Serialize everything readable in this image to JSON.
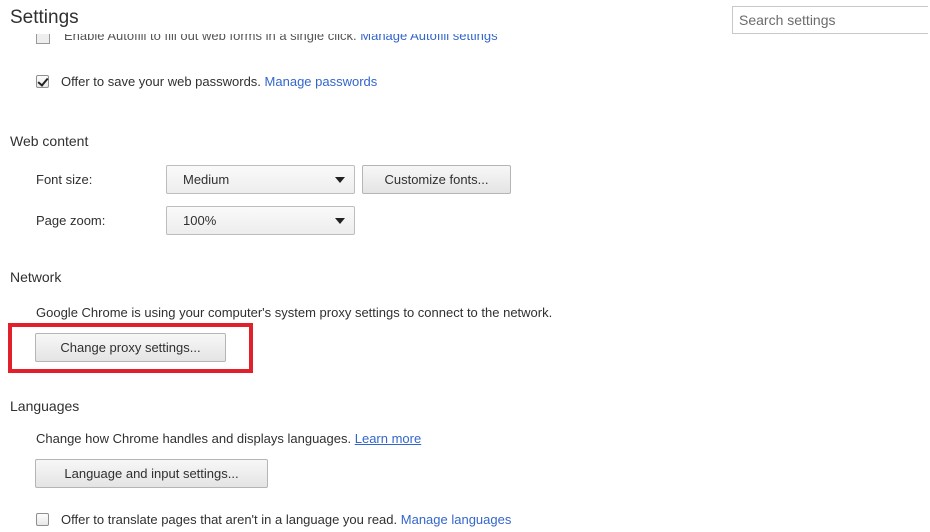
{
  "header": {
    "title": "Settings",
    "search_placeholder": "Search settings"
  },
  "passwords": {
    "autofill_clipped_text": "Enable Autofill to fill out web forms in a single click.",
    "autofill_clipped_link": "Manage Autofill settings",
    "offer_save_label": "Offer to save your web passwords.",
    "offer_save_checked": true,
    "manage_passwords_link": "Manage passwords"
  },
  "web_content": {
    "title": "Web content",
    "font_size_label": "Font size:",
    "font_size_value": "Medium",
    "customize_fonts_button": "Customize fonts...",
    "page_zoom_label": "Page zoom:",
    "page_zoom_value": "100%"
  },
  "network": {
    "title": "Network",
    "description": "Google Chrome is using your computer's system proxy settings to connect to the network.",
    "change_proxy_button": "Change proxy settings..."
  },
  "languages": {
    "title": "Languages",
    "description": "Change how Chrome handles and displays languages.",
    "learn_more_link": "Learn more",
    "language_input_button": "Language and input settings...",
    "offer_translate_label": "Offer to translate pages that aren't in a language you read.",
    "offer_translate_checked": false,
    "manage_languages_link": "Manage languages"
  },
  "annotation": {
    "highlight_color": "#e0202a"
  }
}
